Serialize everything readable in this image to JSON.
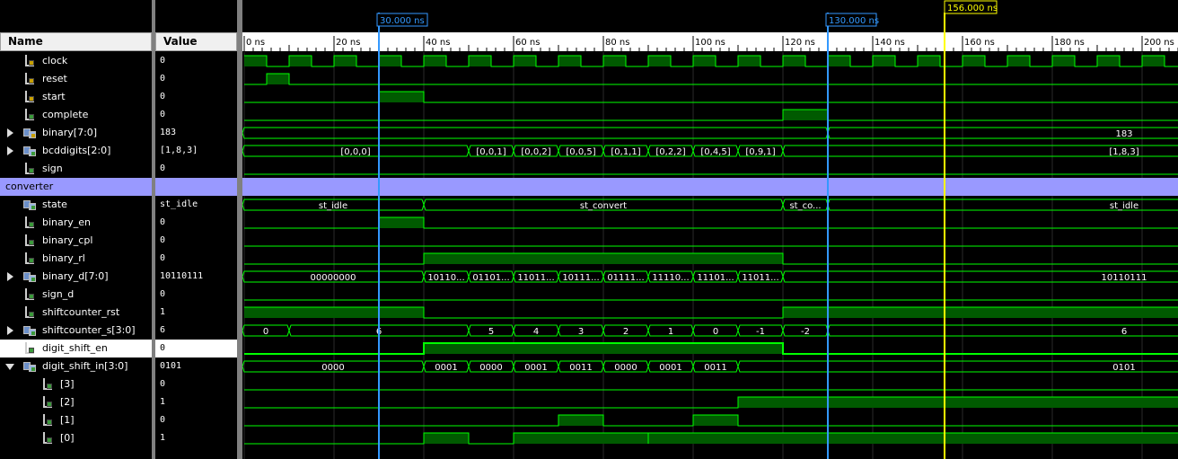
{
  "headers": {
    "name": "Name",
    "value": "Value"
  },
  "time_axis": {
    "ticks": [
      "0 ns",
      "20 ns",
      "40 ns",
      "60 ns",
      "80 ns",
      "100 ns",
      "120 ns",
      "140 ns",
      "160 ns",
      "180 ns",
      "200 ns"
    ],
    "cursors": [
      {
        "label": "30.000 ns",
        "time": 30,
        "color": "#3399ff"
      },
      {
        "label": "130.000 ns",
        "time": 130,
        "color": "#3399ff"
      },
      {
        "label": "156.000 ns",
        "time": 156,
        "color": "#ffff00"
      }
    ]
  },
  "signals": [
    {
      "name": "clock",
      "value": "0",
      "kind": "bit",
      "icon": "in"
    },
    {
      "name": "reset",
      "value": "0",
      "kind": "bit",
      "icon": "in"
    },
    {
      "name": "start",
      "value": "0",
      "kind": "bit",
      "icon": "in"
    },
    {
      "name": "complete",
      "value": "0",
      "kind": "bit",
      "icon": "out"
    },
    {
      "name": "binary[7:0]",
      "value": "183",
      "kind": "bus",
      "icon": "in",
      "expander": "closed"
    },
    {
      "name": "bcddigits[2:0]",
      "value": "[1,8,3]",
      "kind": "bus",
      "icon": "out",
      "expander": "closed"
    },
    {
      "name": "sign",
      "value": "0",
      "kind": "bit",
      "icon": "out"
    },
    {
      "name": "converter",
      "value": "",
      "kind": "group"
    },
    {
      "name": "state",
      "value": "st_idle",
      "kind": "bus",
      "icon": "out"
    },
    {
      "name": "binary_en",
      "value": "0",
      "kind": "bit",
      "icon": "out"
    },
    {
      "name": "binary_cpl",
      "value": "0",
      "kind": "bit",
      "icon": "out"
    },
    {
      "name": "binary_rl",
      "value": "0",
      "kind": "bit",
      "icon": "out"
    },
    {
      "name": "binary_d[7:0]",
      "value": "10110111",
      "kind": "bus",
      "icon": "out",
      "expander": "closed"
    },
    {
      "name": "sign_d",
      "value": "0",
      "kind": "bit",
      "icon": "out"
    },
    {
      "name": "shiftcounter_rst",
      "value": "1",
      "kind": "bit",
      "icon": "out"
    },
    {
      "name": "shiftcounter_s[3:0]",
      "value": "6",
      "kind": "bus",
      "icon": "out",
      "expander": "closed"
    },
    {
      "name": "digit_shift_en",
      "value": "0",
      "kind": "bit",
      "icon": "out",
      "selected": true
    },
    {
      "name": "digit_shift_in[3:0]",
      "value": "0101",
      "kind": "bus",
      "icon": "out",
      "expander": "open"
    },
    {
      "name": "[3]",
      "value": "0",
      "kind": "bit",
      "icon": "out",
      "indent": true
    },
    {
      "name": "[2]",
      "value": "1",
      "kind": "bit",
      "icon": "out",
      "indent": true
    },
    {
      "name": "[1]",
      "value": "0",
      "kind": "bit",
      "icon": "out",
      "indent": true
    },
    {
      "name": "[0]",
      "value": "1",
      "kind": "bit",
      "icon": "out",
      "indent": true
    }
  ],
  "waves": {
    "clock": {
      "type": "clock",
      "period": 10,
      "high_first": true
    },
    "reset": {
      "type": "bit",
      "edges": [
        [
          0,
          0
        ],
        [
          5,
          1
        ],
        [
          10,
          0
        ]
      ]
    },
    "start": {
      "type": "bit",
      "edges": [
        [
          0,
          0
        ],
        [
          30,
          1
        ],
        [
          40,
          0
        ]
      ]
    },
    "complete": {
      "type": "bit",
      "edges": [
        [
          0,
          0
        ],
        [
          120,
          1
        ],
        [
          130,
          0
        ]
      ]
    },
    "binary[7:0]": {
      "type": "bus",
      "segments": [
        [
          0,
          130,
          ""
        ],
        [
          130,
          210,
          "183"
        ]
      ]
    },
    "bcddigits[2:0]": {
      "type": "bus",
      "segments": [
        [
          0,
          50,
          "[0,0,0]"
        ],
        [
          50,
          60,
          "[0,0,1]"
        ],
        [
          60,
          70,
          "[0,0,2]"
        ],
        [
          70,
          80,
          "[0,0,5]"
        ],
        [
          80,
          90,
          "[0,1,1]"
        ],
        [
          90,
          100,
          "[0,2,2]"
        ],
        [
          100,
          110,
          "[0,4,5]"
        ],
        [
          110,
          120,
          "[0,9,1]"
        ],
        [
          120,
          210,
          "[1,8,3]"
        ]
      ]
    },
    "sign": {
      "type": "bit",
      "edges": [
        [
          0,
          0
        ]
      ]
    },
    "state": {
      "type": "bus",
      "segments": [
        [
          0,
          40,
          "st_idle"
        ],
        [
          40,
          120,
          "st_convert"
        ],
        [
          120,
          130,
          "st_co..."
        ],
        [
          130,
          210,
          "st_idle"
        ]
      ]
    },
    "binary_en": {
      "type": "bit",
      "edges": [
        [
          0,
          0
        ],
        [
          30,
          1
        ],
        [
          40,
          0
        ]
      ]
    },
    "binary_cpl": {
      "type": "bit",
      "edges": [
        [
          0,
          0
        ]
      ]
    },
    "binary_rl": {
      "type": "bit",
      "edges": [
        [
          0,
          0
        ],
        [
          40,
          1
        ],
        [
          120,
          0
        ]
      ]
    },
    "binary_d[7:0]": {
      "type": "bus",
      "segments": [
        [
          0,
          40,
          "00000000"
        ],
        [
          40,
          50,
          "10110..."
        ],
        [
          50,
          60,
          "01101..."
        ],
        [
          60,
          70,
          "11011..."
        ],
        [
          70,
          80,
          "10111..."
        ],
        [
          80,
          90,
          "01111..."
        ],
        [
          90,
          100,
          "11110..."
        ],
        [
          100,
          110,
          "11101..."
        ],
        [
          110,
          120,
          "11011..."
        ],
        [
          120,
          210,
          "10110111"
        ]
      ]
    },
    "sign_d": {
      "type": "bit",
      "edges": [
        [
          0,
          0
        ]
      ]
    },
    "shiftcounter_rst": {
      "type": "bit",
      "edges": [
        [
          0,
          1
        ],
        [
          40,
          0
        ],
        [
          120,
          1
        ]
      ]
    },
    "shiftcounter_s[3:0]": {
      "type": "bus",
      "segments": [
        [
          0,
          10,
          "0"
        ],
        [
          10,
          50,
          "6"
        ],
        [
          50,
          60,
          "5"
        ],
        [
          60,
          70,
          "4"
        ],
        [
          70,
          80,
          "3"
        ],
        [
          80,
          90,
          "2"
        ],
        [
          90,
          100,
          "1"
        ],
        [
          100,
          110,
          "0"
        ],
        [
          110,
          120,
          "-1"
        ],
        [
          120,
          130,
          "-2"
        ],
        [
          130,
          210,
          "6"
        ]
      ]
    },
    "digit_shift_en": {
      "type": "bit",
      "edges": [
        [
          0,
          0
        ],
        [
          40,
          1
        ],
        [
          120,
          0
        ]
      ],
      "bold": true
    },
    "digit_shift_in[3:0]": {
      "type": "bus",
      "segments": [
        [
          0,
          40,
          "0000"
        ],
        [
          40,
          50,
          "0001"
        ],
        [
          50,
          60,
          "0000"
        ],
        [
          60,
          70,
          "0001"
        ],
        [
          70,
          80,
          "0011"
        ],
        [
          80,
          90,
          "0000"
        ],
        [
          90,
          100,
          "0001"
        ],
        [
          100,
          110,
          "0011"
        ],
        [
          110,
          210,
          "0101"
        ]
      ]
    },
    "[3]": {
      "type": "bit",
      "edges": [
        [
          0,
          0
        ]
      ]
    },
    "[2]": {
      "type": "bit",
      "edges": [
        [
          0,
          0
        ],
        [
          110,
          1
        ]
      ]
    },
    "[1]": {
      "type": "bit",
      "edges": [
        [
          0,
          0
        ],
        [
          70,
          1
        ],
        [
          80,
          0
        ],
        [
          100,
          1
        ],
        [
          110,
          0
        ]
      ]
    },
    "[0]": {
      "type": "bit",
      "edges": [
        [
          0,
          0
        ],
        [
          40,
          1
        ],
        [
          50,
          0
        ],
        [
          60,
          1
        ],
        [
          90,
          0
        ],
        [
          90,
          1
        ]
      ]
    }
  }
}
